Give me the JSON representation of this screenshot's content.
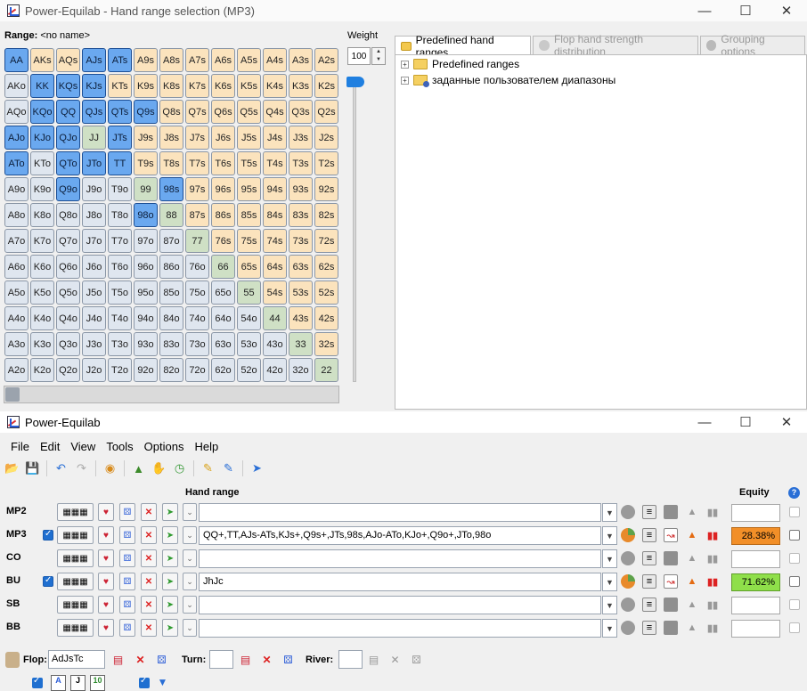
{
  "range_window": {
    "title": "Power-Equilab - Hand range selection (MP3)",
    "range_prefix": "Range:",
    "range_name": "<no name>",
    "weight_label": "Weight",
    "weight_value": "100",
    "tabs": [
      {
        "label": "Predefined hand ranges",
        "active": true
      },
      {
        "label": "Flop hand strength distribution",
        "active": false
      },
      {
        "label": "Grouping options",
        "active": false
      }
    ],
    "tree": [
      {
        "label": "Predefined ranges"
      },
      {
        "label": "заданные пользователем диапазоны"
      }
    ],
    "grid": [
      [
        "AA",
        "AKs",
        "AQs",
        "AJs",
        "ATs",
        "A9s",
        "A8s",
        "A7s",
        "A6s",
        "A5s",
        "A4s",
        "A3s",
        "A2s"
      ],
      [
        "AKo",
        "KK",
        "KQs",
        "KJs",
        "KTs",
        "K9s",
        "K8s",
        "K7s",
        "K6s",
        "K5s",
        "K4s",
        "K3s",
        "K2s"
      ],
      [
        "AQo",
        "KQo",
        "QQ",
        "QJs",
        "QTs",
        "Q9s",
        "Q8s",
        "Q7s",
        "Q6s",
        "Q5s",
        "Q4s",
        "Q3s",
        "Q2s"
      ],
      [
        "AJo",
        "KJo",
        "QJo",
        "JJ",
        "JTs",
        "J9s",
        "J8s",
        "J7s",
        "J6s",
        "J5s",
        "J4s",
        "J3s",
        "J2s"
      ],
      [
        "ATo",
        "KTo",
        "QTo",
        "JTo",
        "TT",
        "T9s",
        "T8s",
        "T7s",
        "T6s",
        "T5s",
        "T4s",
        "T3s",
        "T2s"
      ],
      [
        "A9o",
        "K9o",
        "Q9o",
        "J9o",
        "T9o",
        "99",
        "98s",
        "97s",
        "96s",
        "95s",
        "94s",
        "93s",
        "92s"
      ],
      [
        "A8o",
        "K8o",
        "Q8o",
        "J8o",
        "T8o",
        "98o",
        "88",
        "87s",
        "86s",
        "85s",
        "84s",
        "83s",
        "82s"
      ],
      [
        "A7o",
        "K7o",
        "Q7o",
        "J7o",
        "T7o",
        "97o",
        "87o",
        "77",
        "76s",
        "75s",
        "74s",
        "73s",
        "72s"
      ],
      [
        "A6o",
        "K6o",
        "Q6o",
        "J6o",
        "T6o",
        "96o",
        "86o",
        "76o",
        "66",
        "65s",
        "64s",
        "63s",
        "62s"
      ],
      [
        "A5o",
        "K5o",
        "Q5o",
        "J5o",
        "T5o",
        "95o",
        "85o",
        "75o",
        "65o",
        "55",
        "54s",
        "53s",
        "52s"
      ],
      [
        "A4o",
        "K4o",
        "Q4o",
        "J4o",
        "T4o",
        "94o",
        "84o",
        "74o",
        "64o",
        "54o",
        "44",
        "43s",
        "42s"
      ],
      [
        "A3o",
        "K3o",
        "Q3o",
        "J3o",
        "T3o",
        "93o",
        "83o",
        "73o",
        "63o",
        "53o",
        "43o",
        "33",
        "32s"
      ],
      [
        "A2o",
        "K2o",
        "Q2o",
        "J2o",
        "T2o",
        "92o",
        "82o",
        "72o",
        "62o",
        "52o",
        "42o",
        "32o",
        "22"
      ]
    ],
    "selected": [
      "AA",
      "AJs",
      "ATs",
      "KK",
      "KQs",
      "KJs",
      "KQo",
      "QQ",
      "QJs",
      "QTs",
      "Q9s",
      "AJo",
      "KJo",
      "QJo",
      "JTs",
      "ATo",
      "QTo",
      "JTo",
      "TT",
      "Q9o",
      "98s",
      "98o"
    ]
  },
  "main_window": {
    "title": "Power-Equilab",
    "menu": [
      "File",
      "Edit",
      "View",
      "Tools",
      "Options",
      "Help"
    ],
    "hand_range_label": "Hand range",
    "equity_label": "Equity",
    "players": [
      {
        "name": "MP2",
        "checked": false,
        "range": "",
        "equity": "",
        "active": false
      },
      {
        "name": "MP3",
        "checked": true,
        "range": "QQ+,TT,AJs-ATs,KJs+,Q9s+,JTs,98s,AJo-ATo,KJo+,Q9o+,JTo,98o",
        "equity": "28.38%",
        "active": true,
        "equity_color": "orange"
      },
      {
        "name": "CO",
        "checked": false,
        "range": "",
        "equity": "",
        "active": false
      },
      {
        "name": "BU",
        "checked": true,
        "range": "JhJc",
        "equity": "71.62%",
        "active": true,
        "equity_color": "green"
      },
      {
        "name": "SB",
        "checked": false,
        "range": "",
        "equity": "",
        "active": false
      },
      {
        "name": "BB",
        "checked": false,
        "range": "",
        "equity": "",
        "active": false
      }
    ],
    "board": {
      "flop_label": "Flop:",
      "flop_value": "AdJsTc",
      "turn_label": "Turn:",
      "turn_value": "",
      "river_label": "River:",
      "river_value": ""
    },
    "mini_cards": [
      "A",
      "J",
      "10"
    ]
  }
}
